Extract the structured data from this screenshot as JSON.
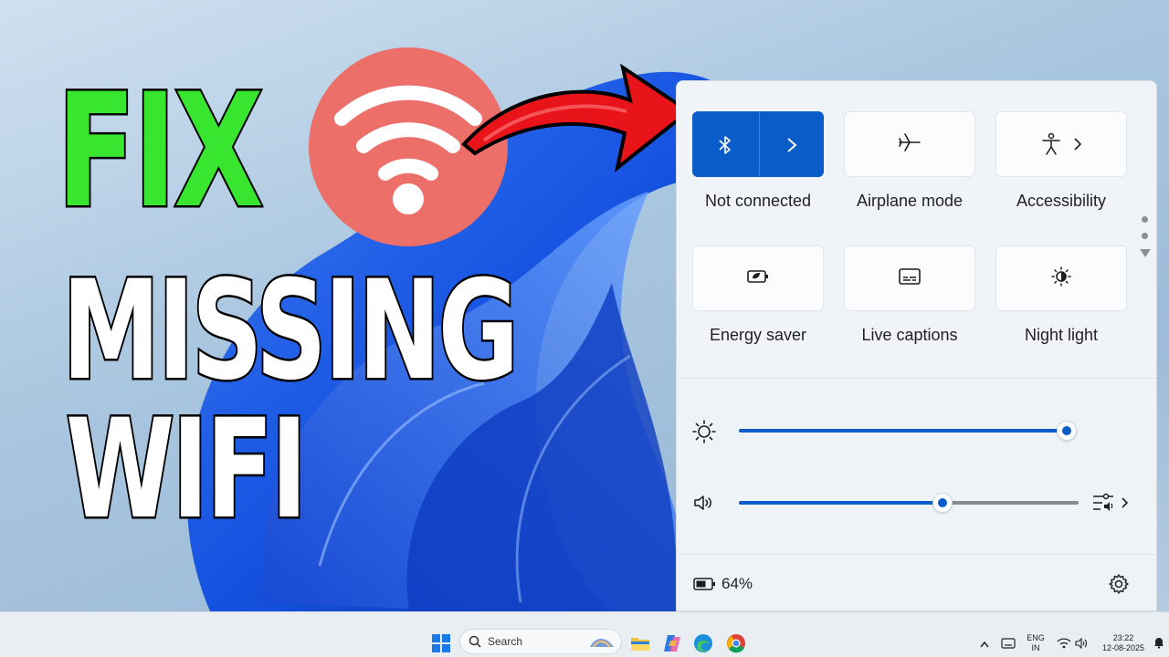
{
  "thumbnail": {
    "line1": "FIX",
    "line2": "MISSING",
    "line3": "WIFI"
  },
  "quick_settings": {
    "tiles": [
      {
        "label": "Not connected",
        "icon": "bluetooth-icon",
        "active": true,
        "has_chevron": true
      },
      {
        "label": "Airplane mode",
        "icon": "airplane-icon",
        "active": false
      },
      {
        "label": "Accessibility",
        "icon": "accessibility-icon",
        "active": false,
        "has_chevron": true
      },
      {
        "label": "Energy saver",
        "icon": "energy-saver-icon",
        "active": false
      },
      {
        "label": "Live captions",
        "icon": "captions-icon",
        "active": false
      },
      {
        "label": "Night light",
        "icon": "night-light-icon",
        "active": false
      }
    ],
    "brightness": {
      "icon": "brightness-icon",
      "level": 1.0
    },
    "volume": {
      "icon": "speaker-icon",
      "level": 0.6
    },
    "battery": {
      "icon": "battery-icon",
      "percent_label": "64%"
    },
    "settings_icon": "gear-icon"
  },
  "taskbar": {
    "search_placeholder": "Search",
    "language_line1": "ENG",
    "language_line2": "IN",
    "time": "23:22",
    "date": "12-08-2025"
  },
  "colors": {
    "accent": "#0a5cc8",
    "fix_green": "#39e62f",
    "wifi_red": "#ec6f6a"
  }
}
